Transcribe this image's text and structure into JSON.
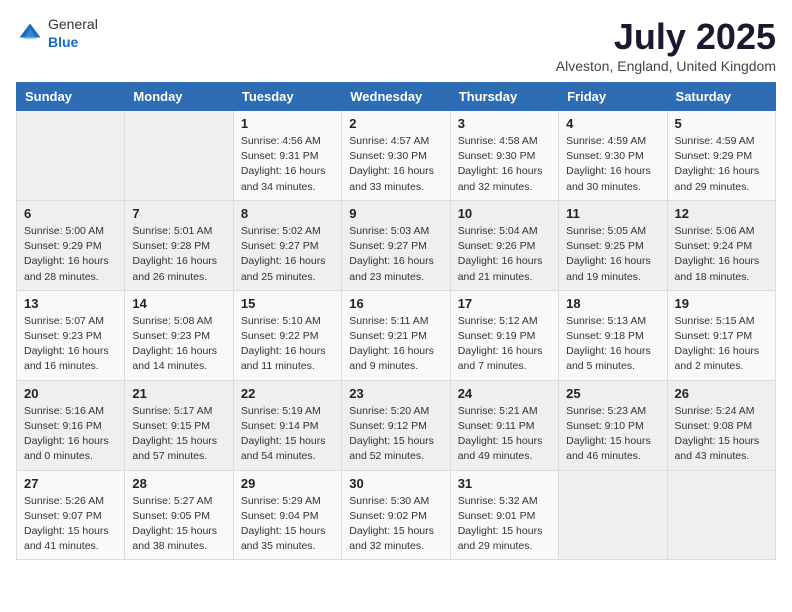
{
  "header": {
    "logo_general": "General",
    "logo_blue": "Blue",
    "month": "July 2025",
    "location": "Alveston, England, United Kingdom"
  },
  "days_of_week": [
    "Sunday",
    "Monday",
    "Tuesday",
    "Wednesday",
    "Thursday",
    "Friday",
    "Saturday"
  ],
  "weeks": [
    [
      {
        "day": "",
        "info": ""
      },
      {
        "day": "",
        "info": ""
      },
      {
        "day": "1",
        "info": "Sunrise: 4:56 AM\nSunset: 9:31 PM\nDaylight: 16 hours and 34 minutes."
      },
      {
        "day": "2",
        "info": "Sunrise: 4:57 AM\nSunset: 9:30 PM\nDaylight: 16 hours and 33 minutes."
      },
      {
        "day": "3",
        "info": "Sunrise: 4:58 AM\nSunset: 9:30 PM\nDaylight: 16 hours and 32 minutes."
      },
      {
        "day": "4",
        "info": "Sunrise: 4:59 AM\nSunset: 9:30 PM\nDaylight: 16 hours and 30 minutes."
      },
      {
        "day": "5",
        "info": "Sunrise: 4:59 AM\nSunset: 9:29 PM\nDaylight: 16 hours and 29 minutes."
      }
    ],
    [
      {
        "day": "6",
        "info": "Sunrise: 5:00 AM\nSunset: 9:29 PM\nDaylight: 16 hours and 28 minutes."
      },
      {
        "day": "7",
        "info": "Sunrise: 5:01 AM\nSunset: 9:28 PM\nDaylight: 16 hours and 26 minutes."
      },
      {
        "day": "8",
        "info": "Sunrise: 5:02 AM\nSunset: 9:27 PM\nDaylight: 16 hours and 25 minutes."
      },
      {
        "day": "9",
        "info": "Sunrise: 5:03 AM\nSunset: 9:27 PM\nDaylight: 16 hours and 23 minutes."
      },
      {
        "day": "10",
        "info": "Sunrise: 5:04 AM\nSunset: 9:26 PM\nDaylight: 16 hours and 21 minutes."
      },
      {
        "day": "11",
        "info": "Sunrise: 5:05 AM\nSunset: 9:25 PM\nDaylight: 16 hours and 19 minutes."
      },
      {
        "day": "12",
        "info": "Sunrise: 5:06 AM\nSunset: 9:24 PM\nDaylight: 16 hours and 18 minutes."
      }
    ],
    [
      {
        "day": "13",
        "info": "Sunrise: 5:07 AM\nSunset: 9:23 PM\nDaylight: 16 hours and 16 minutes."
      },
      {
        "day": "14",
        "info": "Sunrise: 5:08 AM\nSunset: 9:23 PM\nDaylight: 16 hours and 14 minutes."
      },
      {
        "day": "15",
        "info": "Sunrise: 5:10 AM\nSunset: 9:22 PM\nDaylight: 16 hours and 11 minutes."
      },
      {
        "day": "16",
        "info": "Sunrise: 5:11 AM\nSunset: 9:21 PM\nDaylight: 16 hours and 9 minutes."
      },
      {
        "day": "17",
        "info": "Sunrise: 5:12 AM\nSunset: 9:19 PM\nDaylight: 16 hours and 7 minutes."
      },
      {
        "day": "18",
        "info": "Sunrise: 5:13 AM\nSunset: 9:18 PM\nDaylight: 16 hours and 5 minutes."
      },
      {
        "day": "19",
        "info": "Sunrise: 5:15 AM\nSunset: 9:17 PM\nDaylight: 16 hours and 2 minutes."
      }
    ],
    [
      {
        "day": "20",
        "info": "Sunrise: 5:16 AM\nSunset: 9:16 PM\nDaylight: 16 hours and 0 minutes."
      },
      {
        "day": "21",
        "info": "Sunrise: 5:17 AM\nSunset: 9:15 PM\nDaylight: 15 hours and 57 minutes."
      },
      {
        "day": "22",
        "info": "Sunrise: 5:19 AM\nSunset: 9:14 PM\nDaylight: 15 hours and 54 minutes."
      },
      {
        "day": "23",
        "info": "Sunrise: 5:20 AM\nSunset: 9:12 PM\nDaylight: 15 hours and 52 minutes."
      },
      {
        "day": "24",
        "info": "Sunrise: 5:21 AM\nSunset: 9:11 PM\nDaylight: 15 hours and 49 minutes."
      },
      {
        "day": "25",
        "info": "Sunrise: 5:23 AM\nSunset: 9:10 PM\nDaylight: 15 hours and 46 minutes."
      },
      {
        "day": "26",
        "info": "Sunrise: 5:24 AM\nSunset: 9:08 PM\nDaylight: 15 hours and 43 minutes."
      }
    ],
    [
      {
        "day": "27",
        "info": "Sunrise: 5:26 AM\nSunset: 9:07 PM\nDaylight: 15 hours and 41 minutes."
      },
      {
        "day": "28",
        "info": "Sunrise: 5:27 AM\nSunset: 9:05 PM\nDaylight: 15 hours and 38 minutes."
      },
      {
        "day": "29",
        "info": "Sunrise: 5:29 AM\nSunset: 9:04 PM\nDaylight: 15 hours and 35 minutes."
      },
      {
        "day": "30",
        "info": "Sunrise: 5:30 AM\nSunset: 9:02 PM\nDaylight: 15 hours and 32 minutes."
      },
      {
        "day": "31",
        "info": "Sunrise: 5:32 AM\nSunset: 9:01 PM\nDaylight: 15 hours and 29 minutes."
      },
      {
        "day": "",
        "info": ""
      },
      {
        "day": "",
        "info": ""
      }
    ]
  ]
}
